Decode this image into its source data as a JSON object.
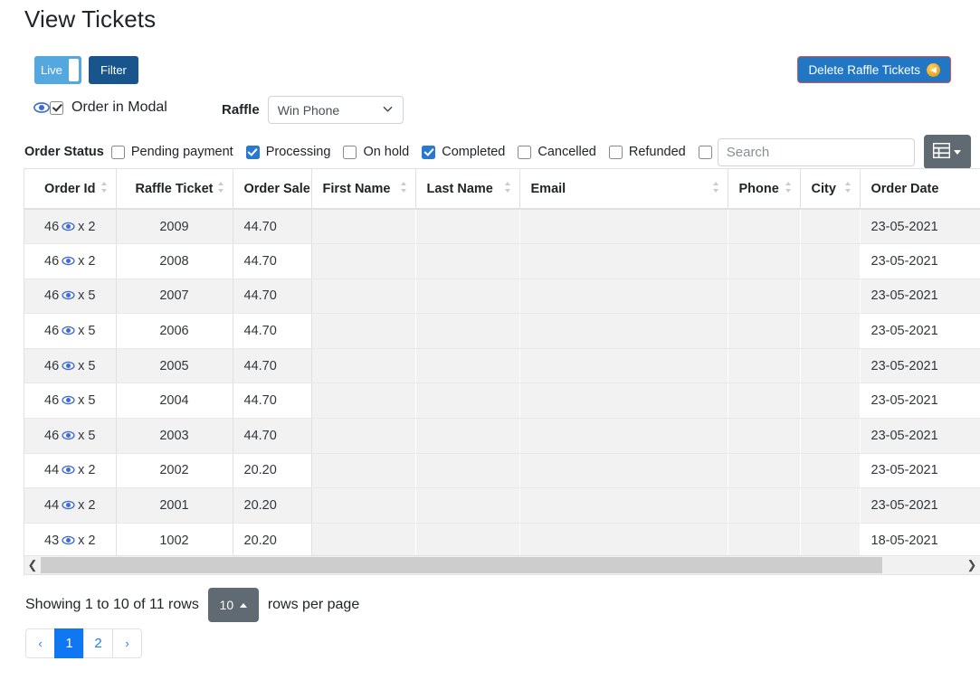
{
  "page_title": "View Tickets",
  "toolbar": {
    "live_toggle_label": "Live",
    "live_toggle_on": true,
    "filter_label": "Filter",
    "delete_label": "Delete Raffle Tickets",
    "delete_icon": "coin-arrow-icon"
  },
  "modal_option": {
    "icon": "eye-icon",
    "label": "Order in Modal",
    "checked": true
  },
  "raffle": {
    "label": "Raffle",
    "selected": "Win Phone",
    "options": [
      "Win Phone"
    ]
  },
  "order_status": {
    "label": "Order Status",
    "items": [
      {
        "label": "Pending payment",
        "checked": false
      },
      {
        "label": "Processing",
        "checked": true
      },
      {
        "label": "On hold",
        "checked": false
      },
      {
        "label": "Completed",
        "checked": true
      },
      {
        "label": "Cancelled",
        "checked": false
      },
      {
        "label": "Refunded",
        "checked": false
      },
      {
        "label": "",
        "checked": false
      }
    ]
  },
  "search": {
    "value": "",
    "placeholder": "Search"
  },
  "columns_button": {
    "icon": "table-columns-icon"
  },
  "table": {
    "headers": [
      {
        "label": "Order Id",
        "sortable": true
      },
      {
        "label": "Raffle Ticket",
        "sortable": true
      },
      {
        "label": "Order Sale",
        "sortable": false
      },
      {
        "label": "First Name",
        "sortable": true
      },
      {
        "label": "Last Name",
        "sortable": true
      },
      {
        "label": "Email",
        "sortable": true
      },
      {
        "label": "Phone",
        "sortable": true
      },
      {
        "label": "City",
        "sortable": true
      },
      {
        "label": "Order Date",
        "sortable": false
      }
    ],
    "rows": [
      {
        "order_id": "46",
        "qty": "x 2",
        "raffle_ticket": "2009",
        "order_sale": "44.70",
        "first_name": "",
        "last_name": "",
        "email": "",
        "phone": "",
        "city": "",
        "order_date": "23-05-2021"
      },
      {
        "order_id": "46",
        "qty": "x 2",
        "raffle_ticket": "2008",
        "order_sale": "44.70",
        "first_name": "",
        "last_name": "",
        "email": "",
        "phone": "",
        "city": "",
        "order_date": "23-05-2021"
      },
      {
        "order_id": "46",
        "qty": "x 5",
        "raffle_ticket": "2007",
        "order_sale": "44.70",
        "first_name": "",
        "last_name": "",
        "email": "",
        "phone": "",
        "city": "",
        "order_date": "23-05-2021"
      },
      {
        "order_id": "46",
        "qty": "x 5",
        "raffle_ticket": "2006",
        "order_sale": "44.70",
        "first_name": "",
        "last_name": "",
        "email": "",
        "phone": "",
        "city": "",
        "order_date": "23-05-2021"
      },
      {
        "order_id": "46",
        "qty": "x 5",
        "raffle_ticket": "2005",
        "order_sale": "44.70",
        "first_name": "",
        "last_name": "",
        "email": "",
        "phone": "",
        "city": "",
        "order_date": "23-05-2021"
      },
      {
        "order_id": "46",
        "qty": "x 5",
        "raffle_ticket": "2004",
        "order_sale": "44.70",
        "first_name": "",
        "last_name": "",
        "email": "",
        "phone": "",
        "city": "",
        "order_date": "23-05-2021"
      },
      {
        "order_id": "46",
        "qty": "x 5",
        "raffle_ticket": "2003",
        "order_sale": "44.70",
        "first_name": "",
        "last_name": "",
        "email": "",
        "phone": "",
        "city": "",
        "order_date": "23-05-2021"
      },
      {
        "order_id": "44",
        "qty": "x 2",
        "raffle_ticket": "2002",
        "order_sale": "20.20",
        "first_name": "",
        "last_name": "",
        "email": "",
        "phone": "",
        "city": "",
        "order_date": "23-05-2021"
      },
      {
        "order_id": "44",
        "qty": "x 2",
        "raffle_ticket": "2001",
        "order_sale": "20.20",
        "first_name": "",
        "last_name": "",
        "email": "",
        "phone": "",
        "city": "",
        "order_date": "23-05-2021"
      },
      {
        "order_id": "43",
        "qty": "x 2",
        "raffle_ticket": "1002",
        "order_sale": "20.20",
        "first_name": "",
        "last_name": "",
        "email": "",
        "phone": "",
        "city": "",
        "order_date": "18-05-2021"
      }
    ]
  },
  "footer": {
    "showing_text": "Showing 1 to 10 of 11 rows",
    "rows_per_page_value": "10",
    "rows_per_page_label": "rows per page"
  },
  "pagination": {
    "prev": "‹",
    "next": "›",
    "pages": [
      "1",
      "2"
    ],
    "active": "1"
  },
  "colors": {
    "primary_blue": "#1077f2",
    "filter_blue": "#18558c",
    "live_blue": "#54a8dd",
    "danger_border": "#d9534f",
    "gray_button": "#5f6a72"
  }
}
